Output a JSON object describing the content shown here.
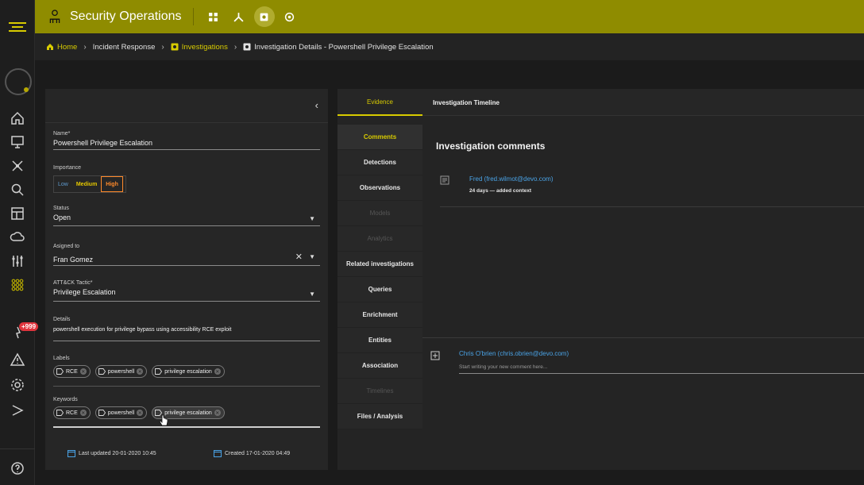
{
  "app": {
    "title": "Security Operations"
  },
  "breadcrumb": [
    {
      "label": "Home",
      "type": "link"
    },
    {
      "label": "Incident Response",
      "type": "plain"
    },
    {
      "label": "Investigations",
      "type": "link"
    },
    {
      "label": "Investigation Details - Powershell Privilege Escalation",
      "type": "plain"
    }
  ],
  "rail": {
    "badge": "+999",
    "items": [
      "home-icon",
      "monitor-icon",
      "network-icon",
      "search-icon",
      "dashboard-icon",
      "cloud-icon",
      "filters-icon",
      "grid-icon",
      "alerts-icon",
      "warning-icon",
      "settings-icon",
      "share-icon",
      "help-icon"
    ]
  },
  "form": {
    "collapse_glyph": "‹",
    "name": {
      "label": "Name*",
      "value": "Powershell Privilege Escalation"
    },
    "importance": {
      "label": "Importance",
      "options": [
        "Low",
        "Medium",
        "High"
      ],
      "selected": "High"
    },
    "status": {
      "label": "Status",
      "value": "Open"
    },
    "assigned": {
      "label": "Asigned to",
      "value": "Fran Gomez"
    },
    "tactic": {
      "label": "ATT&CK Tactic*",
      "value": "Privilege Escalation"
    },
    "details": {
      "label": "Details",
      "value": "powershell execution for privilege bypass using accessibility RCE exploit"
    },
    "labels": {
      "label": "Labels",
      "chips": [
        "RCE",
        "powershell",
        "privilege escalation"
      ]
    },
    "keywords": {
      "label": "Keywords",
      "chips": [
        "RCE",
        "powershell",
        "privilege escalation"
      ]
    },
    "last_updated": "Last updated 20-01-2020 10:45",
    "created": "Created 17-01-2020 04:49"
  },
  "tabs": [
    {
      "label": "Evidence",
      "active": true
    },
    {
      "label": "Investigation Timeline",
      "active": false
    }
  ],
  "subnav": [
    {
      "label": "Comments",
      "state": "active"
    },
    {
      "label": "Detections",
      "state": "normal"
    },
    {
      "label": "Observations",
      "state": "normal"
    },
    {
      "label": "Models",
      "state": "disabled"
    },
    {
      "label": "Analytics",
      "state": "disabled"
    },
    {
      "label": "Related investigations",
      "state": "normal"
    },
    {
      "label": "Queries",
      "state": "normal"
    },
    {
      "label": "Enrichment",
      "state": "normal"
    },
    {
      "label": "Entities",
      "state": "normal"
    },
    {
      "label": "Association",
      "state": "normal"
    },
    {
      "label": "Timelines",
      "state": "disabled"
    },
    {
      "label": "Files / Analysis",
      "state": "normal"
    }
  ],
  "comments": {
    "title": "Investigation comments",
    "entries": [
      {
        "author": "Fred (fred.wilmot@devo.com)",
        "meta": "24 days — added context"
      }
    ],
    "new_comment": {
      "author": "Chris O'brien (chris.obrien@devo.com)",
      "placeholder": "Start writing your new comment here..."
    }
  },
  "colors": {
    "accent": "#d8cb00",
    "topbar": "#8f8c00",
    "link": "#4aa3e6",
    "high": "#ff8a2a"
  }
}
